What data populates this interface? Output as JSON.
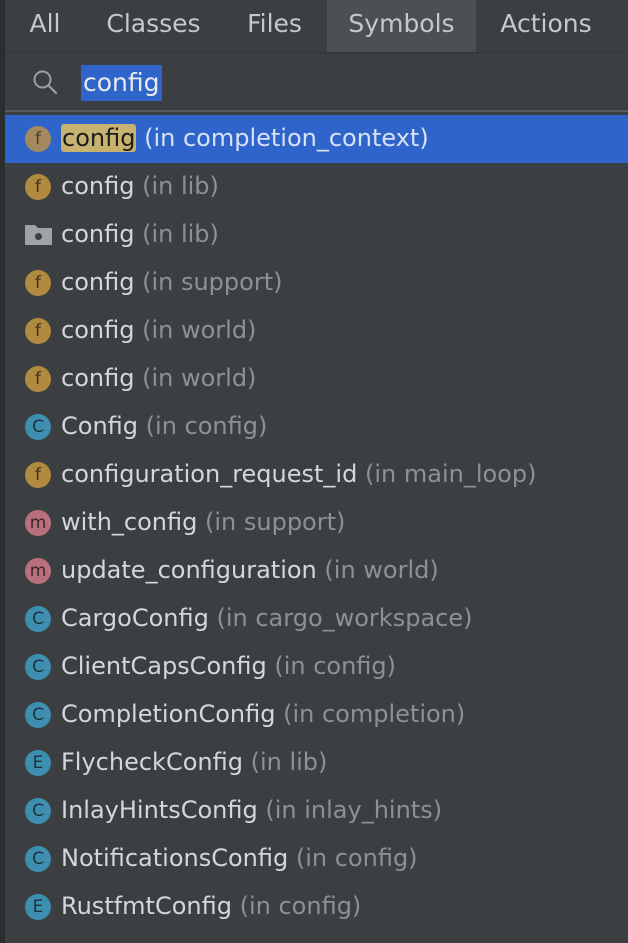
{
  "tabs": [
    {
      "label": "All",
      "selected": false
    },
    {
      "label": "Classes",
      "selected": false
    },
    {
      "label": "Files",
      "selected": false
    },
    {
      "label": "Symbols",
      "selected": true
    },
    {
      "label": "Actions",
      "selected": false
    }
  ],
  "search": {
    "icon": "search-icon",
    "value": "config"
  },
  "results": [
    {
      "kind": "f",
      "name": "config",
      "location": "(in completion_context)",
      "selected": true
    },
    {
      "kind": "f",
      "name": "config",
      "location": "(in lib)"
    },
    {
      "kind": "folder",
      "name": "config",
      "location": "(in lib)"
    },
    {
      "kind": "f",
      "name": "config",
      "location": "(in support)"
    },
    {
      "kind": "f",
      "name": "config",
      "location": "(in world)"
    },
    {
      "kind": "f",
      "name": "config",
      "location": "(in world)"
    },
    {
      "kind": "c",
      "name": "Config",
      "location": "(in config)"
    },
    {
      "kind": "f",
      "name": "configuration_request_id",
      "location": "(in main_loop)"
    },
    {
      "kind": "m",
      "name": "with_config",
      "location": "(in support)"
    },
    {
      "kind": "m",
      "name": "update_configuration",
      "location": "(in world)"
    },
    {
      "kind": "c",
      "name": "CargoConfig",
      "location": "(in cargo_workspace)"
    },
    {
      "kind": "c",
      "name": "ClientCapsConfig",
      "location": "(in config)"
    },
    {
      "kind": "c",
      "name": "CompletionConfig",
      "location": "(in completion)"
    },
    {
      "kind": "e",
      "name": "FlycheckConfig",
      "location": "(in lib)"
    },
    {
      "kind": "c",
      "name": "InlayHintsConfig",
      "location": "(in inlay_hints)"
    },
    {
      "kind": "c",
      "name": "NotificationsConfig",
      "location": "(in config)"
    },
    {
      "kind": "e",
      "name": "RustfmtConfig",
      "location": "(in config)"
    }
  ],
  "badges": {
    "f": "f",
    "c": "C",
    "m": "m",
    "e": "E"
  },
  "colors": {
    "background": "#3c3f41",
    "selection": "#2f65ca",
    "function_badge": "#b08a3e",
    "class_badge": "#3d8faf",
    "method_badge": "#b8707e",
    "match_highlight": "#c7b36f"
  }
}
